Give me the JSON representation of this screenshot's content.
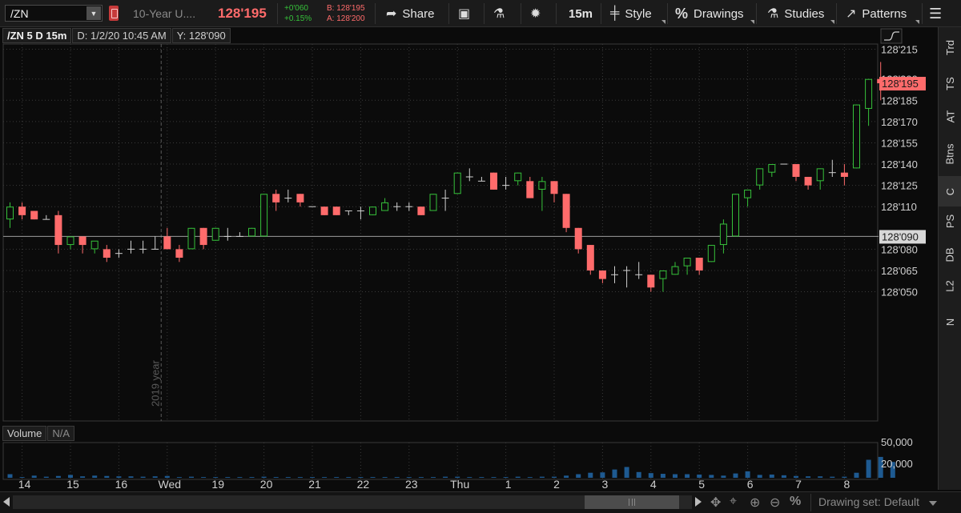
{
  "toolbar": {
    "symbol": "/ZN",
    "description": "10-Year U....",
    "last_price": "128'195",
    "net_change": "+0'060",
    "pct_change": "+0.15%",
    "bid": "B: 128'195",
    "ask": "A: 128'200",
    "share_label": "Share",
    "timeframe_label": "15m",
    "style_label": "Style",
    "drawings_label": "Drawings",
    "studies_label": "Studies",
    "patterns_label": "Patterns"
  },
  "chart_header": {
    "symbol_period": "/ZN 5 D 15m",
    "date_readout": "D: 1/2/20 10:45 AM",
    "y_readout": "Y: 128'090"
  },
  "right_tabs": [
    "Trd",
    "TS",
    "AT",
    "Btns",
    "C",
    "PS",
    "DB",
    "L2",
    "N"
  ],
  "volume_header": {
    "label": "Volume",
    "value": "N/A"
  },
  "bottom": {
    "drawing_set": "Drawing set: Default"
  },
  "colors": {
    "up": "#36c13a",
    "down": "#ff6b6b",
    "price_tag_bg": "#ff6b6b",
    "crosshair_tag_bg": "#d8d8d8",
    "volume": "#1e5a91",
    "background": "#0b0b0b",
    "grid": "#3a3a3a"
  },
  "chart_data": {
    "type": "candlestick",
    "price_unit": "32nds",
    "y_ticks": [
      "128'215",
      "128'200",
      "128'185",
      "128'170",
      "128'155",
      "128'140",
      "128'125",
      "128'110",
      "128'080",
      "128'065",
      "128'050"
    ],
    "y_ticks_32": [
      4119.5,
      4116,
      4113.5,
      4111,
      4108.5,
      4106,
      4103.5,
      4101,
      4096,
      4093.5,
      4091
    ],
    "last_price_tag": "128'195",
    "last_price_32": 4115.5,
    "crosshair_tag": "128'090",
    "crosshair_32": 4097.5,
    "divider_label": "2019 year",
    "divider_index": 12,
    "x_labels": [
      {
        "label": "14",
        "index": 1
      },
      {
        "label": "15",
        "index": 5
      },
      {
        "label": "16",
        "index": 9
      },
      {
        "label": "Wed",
        "index": 13
      },
      {
        "label": "19",
        "index": 17
      },
      {
        "label": "20",
        "index": 21
      },
      {
        "label": "21",
        "index": 25
      },
      {
        "label": "22",
        "index": 29
      },
      {
        "label": "23",
        "index": 33
      },
      {
        "label": "Thu",
        "index": 37
      },
      {
        "label": "1",
        "index": 41
      },
      {
        "label": "2",
        "index": 45
      },
      {
        "label": "3",
        "index": 49
      },
      {
        "label": "4",
        "index": 53
      },
      {
        "label": "5",
        "index": 57
      },
      {
        "label": "6",
        "index": 61
      },
      {
        "label": "7",
        "index": 65
      },
      {
        "label": "8",
        "index": 69
      }
    ],
    "volume_ticks": [
      "50,000",
      "20,000"
    ],
    "volume_ticks_values": [
      50000,
      20000
    ],
    "candles": [
      {
        "o": 4099.5,
        "h": 4101.5,
        "l": 4098.5,
        "c": 4101
      },
      {
        "o": 4101,
        "h": 4101.5,
        "l": 4099.5,
        "c": 4100
      },
      {
        "o": 4100.5,
        "h": 4100.5,
        "l": 4099.5,
        "c": 4099.5
      },
      {
        "o": 4099.5,
        "h": 4100,
        "l": 4099.5,
        "c": 4099.5
      },
      {
        "o": 4100,
        "h": 4100.5,
        "l": 4095.5,
        "c": 4096.5
      },
      {
        "o": 4096.5,
        "h": 4097.5,
        "l": 4096,
        "c": 4097.5
      },
      {
        "o": 4097.5,
        "h": 4097.5,
        "l": 4095.5,
        "c": 4096.5
      },
      {
        "o": 4096,
        "h": 4096.5,
        "l": 4095.5,
        "c": 4097
      },
      {
        "o": 4096,
        "h": 4096.5,
        "l": 4094.5,
        "c": 4095
      },
      {
        "o": 4095.5,
        "h": 4096,
        "l": 4095,
        "c": 4095.5
      },
      {
        "o": 4096,
        "h": 4097,
        "l": 4095.5,
        "c": 4096
      },
      {
        "o": 4096,
        "h": 4097,
        "l": 4095.5,
        "c": 4096
      },
      {
        "o": 4096,
        "h": 4097.5,
        "l": 4096,
        "c": 4096
      },
      {
        "o": 4097.5,
        "h": 4098.5,
        "l": 4096,
        "c": 4096
      },
      {
        "o": 4096,
        "h": 4096.5,
        "l": 4094.5,
        "c": 4095
      },
      {
        "o": 4096,
        "h": 4098.5,
        "l": 4096,
        "c": 4098.5
      },
      {
        "o": 4098.5,
        "h": 4098.5,
        "l": 4096,
        "c": 4096.5
      },
      {
        "o": 4097,
        "h": 4098.5,
        "l": 4097,
        "c": 4098.5
      },
      {
        "o": 4097.5,
        "h": 4098.5,
        "l": 4097,
        "c": 4097.5
      },
      {
        "o": 4097.5,
        "h": 4098,
        "l": 4097.5,
        "c": 4097.5
      },
      {
        "o": 4097.5,
        "h": 4098.5,
        "l": 4097.5,
        "c": 4098.5
      },
      {
        "o": 4097.5,
        "h": 4102.5,
        "l": 4097.5,
        "c": 4102.5
      },
      {
        "o": 4102.5,
        "h": 4103,
        "l": 4100.5,
        "c": 4101.5
      },
      {
        "o": 4102,
        "h": 4103,
        "l": 4101.5,
        "c": 4102
      },
      {
        "o": 4102.5,
        "h": 4102.5,
        "l": 4101,
        "c": 4101.5
      },
      {
        "o": 4101,
        "h": 4101,
        "l": 4101,
        "c": 4101
      },
      {
        "o": 4101,
        "h": 4101,
        "l": 4100,
        "c": 4100
      },
      {
        "o": 4101,
        "h": 4101,
        "l": 4100,
        "c": 4100
      },
      {
        "o": 4100.5,
        "h": 4100.5,
        "l": 4100,
        "c": 4100.5
      },
      {
        "o": 4100.5,
        "h": 4101,
        "l": 4099.5,
        "c": 4100.5
      },
      {
        "o": 4100,
        "h": 4101,
        "l": 4100,
        "c": 4101
      },
      {
        "o": 4100.5,
        "h": 4102,
        "l": 4100.5,
        "c": 4101.5
      },
      {
        "o": 4101,
        "h": 4101.5,
        "l": 4100.5,
        "c": 4101
      },
      {
        "o": 4101,
        "h": 4101.5,
        "l": 4100.5,
        "c": 4101
      },
      {
        "o": 4101,
        "h": 4101,
        "l": 4100,
        "c": 4100
      },
      {
        "o": 4100.5,
        "h": 4102.5,
        "l": 4100.5,
        "c": 4102.5
      },
      {
        "o": 4102,
        "h": 4103,
        "l": 4100.5,
        "c": 4102
      },
      {
        "o": 4102.5,
        "h": 4105,
        "l": 4102.5,
        "c": 4105
      },
      {
        "o": 4104.5,
        "h": 4105.5,
        "l": 4104,
        "c": 4104.5
      },
      {
        "o": 4104,
        "h": 4104.5,
        "l": 4104,
        "c": 4104
      },
      {
        "o": 4105,
        "h": 4105,
        "l": 4103,
        "c": 4103
      },
      {
        "o": 4103.5,
        "h": 4104.5,
        "l": 4103,
        "c": 4103.5
      },
      {
        "o": 4104,
        "h": 4105,
        "l": 4103.5,
        "c": 4105
      },
      {
        "o": 4104,
        "h": 4104.5,
        "l": 4102,
        "c": 4102
      },
      {
        "o": 4103,
        "h": 4104.5,
        "l": 4100.5,
        "c": 4104
      },
      {
        "o": 4104,
        "h": 4104,
        "l": 4101.5,
        "c": 4102.5
      },
      {
        "o": 4102.5,
        "h": 4102.5,
        "l": 4098,
        "c": 4098.5
      },
      {
        "o": 4098.5,
        "h": 4098.5,
        "l": 4095.5,
        "c": 4096
      },
      {
        "o": 4096.5,
        "h": 4096.5,
        "l": 4093,
        "c": 4093.5
      },
      {
        "o": 4093.5,
        "h": 4093.5,
        "l": 4092,
        "c": 4092.5
      },
      {
        "o": 4093,
        "h": 4094,
        "l": 4092,
        "c": 4093
      },
      {
        "o": 4093.5,
        "h": 4094,
        "l": 4091.5,
        "c": 4093.5
      },
      {
        "o": 4093,
        "h": 4094.5,
        "l": 4092.5,
        "c": 4093
      },
      {
        "o": 4093,
        "h": 4093,
        "l": 4091,
        "c": 4091.5
      },
      {
        "o": 4092.5,
        "h": 4093.5,
        "l": 4091,
        "c": 4093.5
      },
      {
        "o": 4093,
        "h": 4094.5,
        "l": 4093,
        "c": 4094
      },
      {
        "o": 4094,
        "h": 4095,
        "l": 4093,
        "c": 4095
      },
      {
        "o": 4095,
        "h": 4095,
        "l": 4093,
        "c": 4093.5
      },
      {
        "o": 4094.5,
        "h": 4096.5,
        "l": 4094.5,
        "c": 4096.5
      },
      {
        "o": 4096.5,
        "h": 4099.5,
        "l": 4095.5,
        "c": 4099
      },
      {
        "o": 4097.5,
        "h": 4102.5,
        "l": 4097.5,
        "c": 4102.5
      },
      {
        "o": 4102,
        "h": 4103,
        "l": 4101,
        "c": 4103
      },
      {
        "o": 4103.5,
        "h": 4105.5,
        "l": 4103,
        "c": 4105.5
      },
      {
        "o": 4105,
        "h": 4106,
        "l": 4104.5,
        "c": 4106
      },
      {
        "o": 4106,
        "h": 4106,
        "l": 4106,
        "c": 4106
      },
      {
        "o": 4106,
        "h": 4106,
        "l": 4104,
        "c": 4104.5
      },
      {
        "o": 4104.5,
        "h": 4104.5,
        "l": 4103,
        "c": 4103.5
      },
      {
        "o": 4104,
        "h": 4105.5,
        "l": 4103,
        "c": 4105.5
      },
      {
        "o": 4105,
        "h": 4106.5,
        "l": 4104.5,
        "c": 4105
      },
      {
        "o": 4105,
        "h": 4106,
        "l": 4103.5,
        "c": 4104.5
      },
      {
        "o": 4105.5,
        "h": 4113,
        "l": 4105.5,
        "c": 4113
      },
      {
        "o": 4112.5,
        "h": 4116,
        "l": 4110.5,
        "c": 4116
      },
      {
        "o": 4116,
        "h": 4118,
        "l": 4113.5,
        "c": 4115.5
      }
    ],
    "volume": [
      5000,
      1000,
      3000,
      1500,
      2500,
      4000,
      2000,
      3000,
      2500,
      2000,
      2000,
      1500,
      2000,
      2500,
      1000,
      1500,
      1000,
      1000,
      1000,
      1000,
      1000,
      1500,
      1000,
      1000,
      1000,
      1000,
      1000,
      1000,
      1000,
      1000,
      1000,
      1000,
      1000,
      1000,
      1000,
      1000,
      1500,
      1500,
      1000,
      1000,
      1000,
      1000,
      1500,
      1000,
      1500,
      1500,
      3000,
      5000,
      7000,
      7500,
      11500,
      15000,
      8000,
      6500,
      5500,
      5000,
      5000,
      4500,
      4000,
      3000,
      6000,
      9000,
      4000,
      4500,
      3500,
      2500,
      2000,
      2000,
      1500,
      1500,
      7000,
      25000,
      29000,
      22000
    ]
  }
}
